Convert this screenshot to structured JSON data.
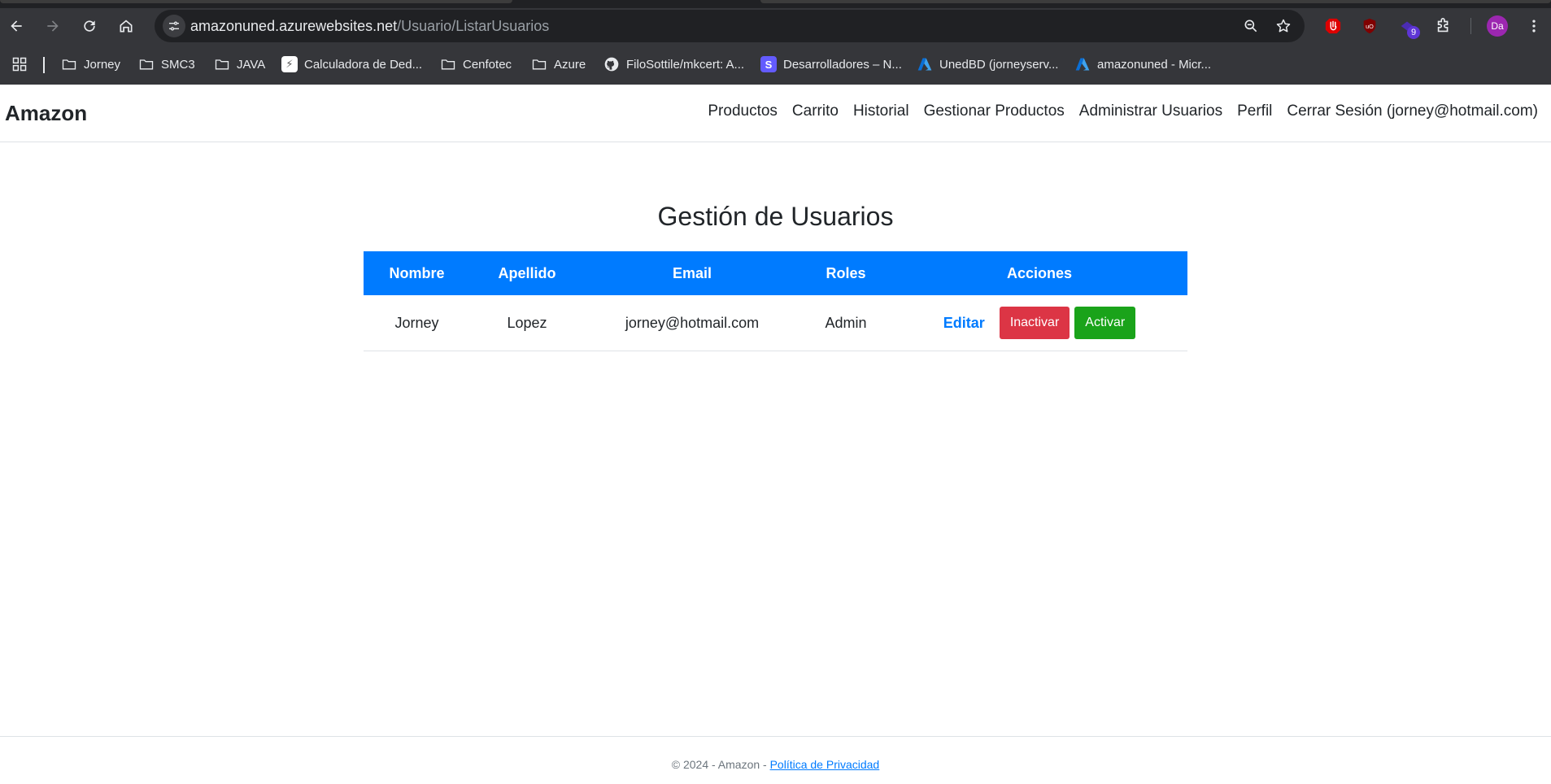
{
  "browser": {
    "url_host": "amazonuned.azurewebsites.net",
    "url_path": "/Usuario/ListarUsuarios",
    "profile_initials": "Da",
    "extension_badge": "9",
    "bookmarks": [
      {
        "label": "Jorney",
        "icon": "folder-icon"
      },
      {
        "label": "SMC3",
        "icon": "folder-icon"
      },
      {
        "label": "JAVA",
        "icon": "folder-icon"
      },
      {
        "label": "Calculadora de Ded...",
        "icon": "calculator-icon"
      },
      {
        "label": "Cenfotec",
        "icon": "folder-icon"
      },
      {
        "label": "Azure",
        "icon": "folder-icon"
      },
      {
        "label": "FiloSottile/mkcert: A...",
        "icon": "github-icon"
      },
      {
        "label": "Desarrolladores – N...",
        "icon": "stripe-icon"
      },
      {
        "label": "UnedBD (jorneyserv...",
        "icon": "azure-icon"
      },
      {
        "label": "amazonuned - Micr...",
        "icon": "azure-icon"
      }
    ]
  },
  "navbar": {
    "brand": "Amazon",
    "links": [
      "Productos",
      "Carrito",
      "Historial",
      "Gestionar Productos",
      "Administrar Usuarios",
      "Perfil",
      "Cerrar Sesión (jorney@hotmail.com)"
    ]
  },
  "main": {
    "title": "Gestión de Usuarios",
    "table": {
      "headers": [
        "Nombre",
        "Apellido",
        "Email",
        "Roles",
        "Acciones"
      ],
      "rows": [
        {
          "nombre": "Jorney",
          "apellido": "Lopez",
          "email": "jorney@hotmail.com",
          "roles": "Admin",
          "actions": {
            "edit": "Editar",
            "deactivate": "Inactivar",
            "activate": "Activar"
          }
        }
      ]
    }
  },
  "footer": {
    "copyright": "© 2024 - Amazon - ",
    "privacy_link": "Política de Privacidad"
  },
  "colors": {
    "chrome_bg": "#35363a",
    "omnibox_bg": "#202124",
    "header_blue": "#007bff",
    "danger": "#dc3545",
    "success": "#1aa31a"
  }
}
